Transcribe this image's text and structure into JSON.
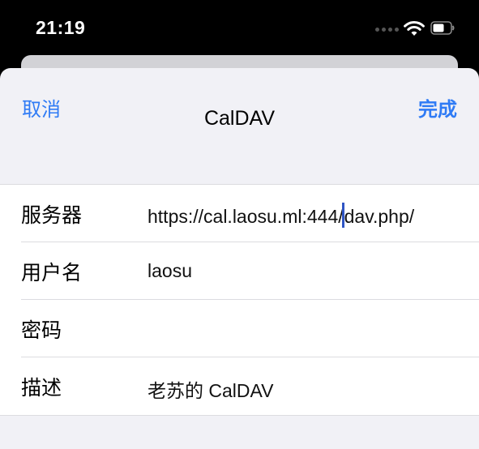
{
  "status_bar": {
    "time": "21:19",
    "icons": [
      "cellular-signal-icon",
      "wifi-icon",
      "battery-icon"
    ]
  },
  "nav": {
    "cancel_label": "取消",
    "title": "CalDAV",
    "done_label": "完成"
  },
  "form": {
    "server": {
      "label": "服务器",
      "value_before_cursor": "https://cal.laosu.ml:444/",
      "value_after_cursor": "dav.php/"
    },
    "username": {
      "label": "用户名",
      "value": "laosu"
    },
    "password": {
      "label": "密码",
      "value": ""
    },
    "description": {
      "label": "描述",
      "value": "老苏的 CalDAV"
    }
  },
  "colors": {
    "accent": "#2f7bf5",
    "sheet_background": "#f1f1f6",
    "cursor": "#2f55c4"
  }
}
